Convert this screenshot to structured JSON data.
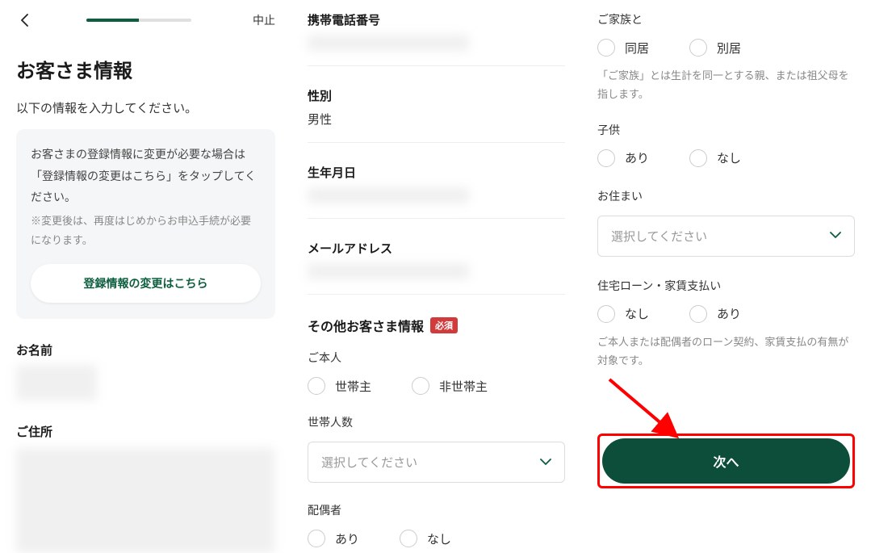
{
  "header": {
    "cancel": "中止"
  },
  "page": {
    "title": "お客さま情報",
    "subtitle": "以下の情報を入力してください。"
  },
  "infobox": {
    "text": "お客さまの登録情報に変更が必要な場合は「登録情報の変更はこちら」をタップしてください。",
    "note": "※変更後は、再度はじめからお申込手続が必要になります。",
    "button": "登録情報の変更はこちら"
  },
  "labels": {
    "name": "お名前",
    "address": "ご住所",
    "phone": "携帯電話番号",
    "gender": "性別",
    "gender_value": "男性",
    "birthdate": "生年月日",
    "email": "メールアドレス"
  },
  "other": {
    "heading": "その他お客さま情報",
    "required": "必須",
    "self": "ご本人",
    "householder": "世帯主",
    "non_householder": "非世帯主",
    "household_count": "世帯人数",
    "select_placeholder": "選択してください",
    "spouse": "配偶者",
    "yes": "あり",
    "no": "なし",
    "family": "ご家族と",
    "cohabit": "同居",
    "separate": "別居",
    "family_note": "「ご家族」とは生計を同一とする親、または祖父母を指します。",
    "children": "子供",
    "residence": "お住まい",
    "loan": "住宅ローン・家賃支払い",
    "loan_note": "ご本人または配偶者のローン契約、家賃支払の有無が対象です。"
  },
  "next": "次へ"
}
